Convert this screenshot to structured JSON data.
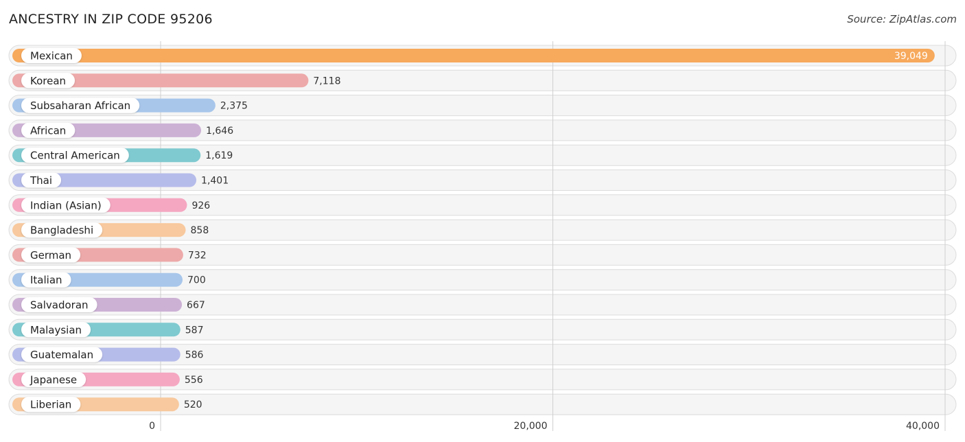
{
  "header": {
    "title": "ANCESTRY IN ZIP CODE 95206",
    "source": "Source: ZipAtlas.com"
  },
  "chart_data": {
    "type": "bar",
    "orientation": "horizontal",
    "title": "ANCESTRY IN ZIP CODE 95206",
    "xlabel": "",
    "ylabel": "",
    "xlim": [
      0,
      40000
    ],
    "x_ticks": [
      0,
      20000,
      40000
    ],
    "x_tick_labels": [
      "0",
      "20,000",
      "40,000"
    ],
    "grid": true,
    "categories": [
      "Mexican",
      "Korean",
      "Subsaharan African",
      "African",
      "Central American",
      "Thai",
      "Indian (Asian)",
      "Bangladeshi",
      "German",
      "Italian",
      "Salvadoran",
      "Malaysian",
      "Guatemalan",
      "Japanese",
      "Liberian"
    ],
    "values": [
      39049,
      7118,
      2375,
      1646,
      1619,
      1401,
      926,
      858,
      732,
      700,
      667,
      587,
      586,
      556,
      520
    ],
    "value_labels": [
      "39,049",
      "7,118",
      "2,375",
      "1,646",
      "1,619",
      "1,401",
      "926",
      "858",
      "732",
      "700",
      "667",
      "587",
      "586",
      "556",
      "520"
    ],
    "colors": [
      "#f7a95c",
      "#eda9a9",
      "#a8c6ea",
      "#cdb1d5",
      "#7fcad0",
      "#b6bcea",
      "#f5a7c1",
      "#f8c99e",
      "#eda9a9",
      "#a8c6ea",
      "#cdb1d5",
      "#7fcad0",
      "#b6bcea",
      "#f5a7c1",
      "#f8c99e"
    ]
  }
}
